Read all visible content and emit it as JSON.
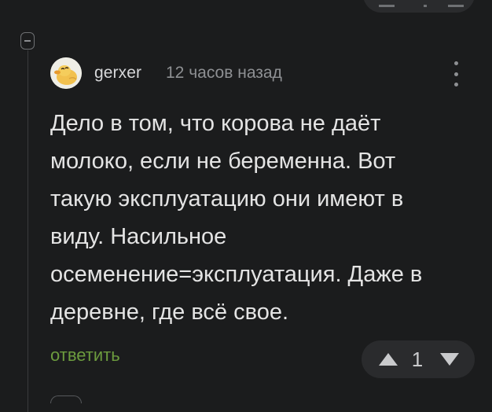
{
  "comment": {
    "author": "gerxer",
    "timestamp": "12 часов назад",
    "body_lines": [
      "Дело в том, что корова не даёт",
      "молоко, если не беременна. Вот",
      "такую эксплуатацию они имеют в",
      "виду. Насильное",
      "осеменение=эксплуатация. Даже в",
      "деревне, где всё свое."
    ],
    "reply_label": "ответить",
    "rating": "1"
  },
  "icons": {
    "collapse": "collapse-minus-icon",
    "more": "more-vertical-icon",
    "upvote": "triangle-up-icon",
    "downvote": "triangle-down-icon",
    "avatar": "duck-avatar"
  },
  "colors": {
    "background": "#1b1c1d",
    "text": "#e4e4e4",
    "muted": "#8e9093",
    "reply_link": "#6c9b3e",
    "vote_pill": "#2a2b2d"
  }
}
